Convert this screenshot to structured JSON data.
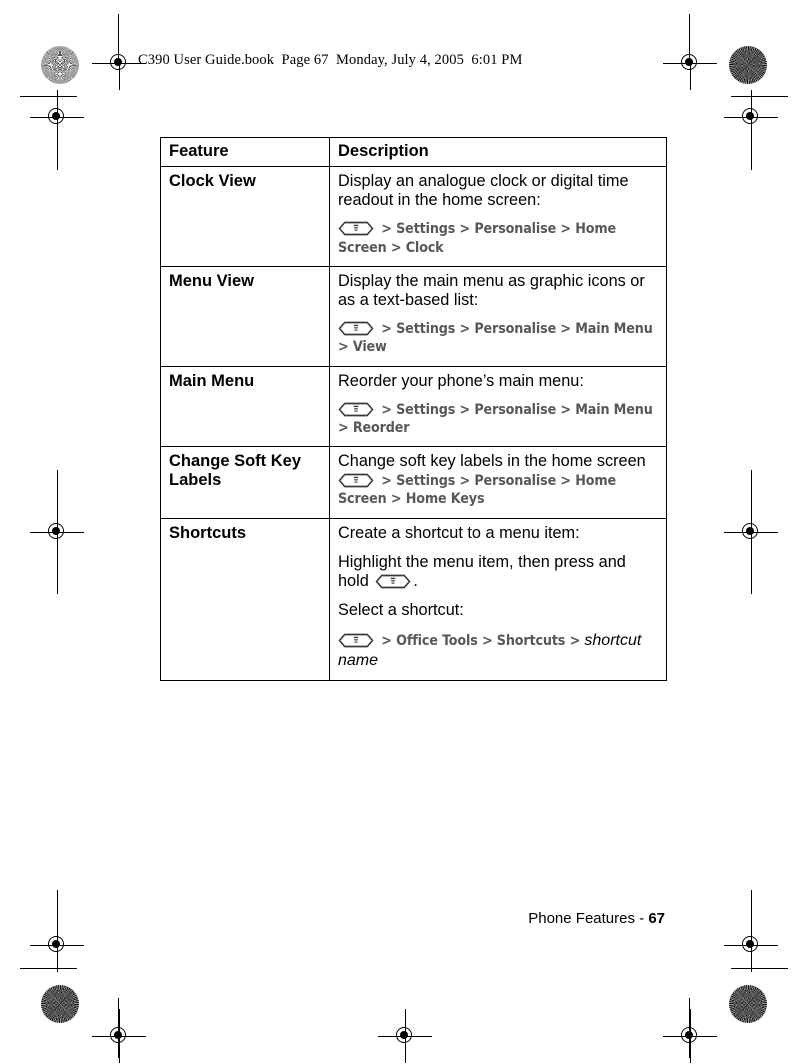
{
  "header": {
    "text": "C390 User Guide.book  Page 67  Monday, July 4, 2005  6:01 PM"
  },
  "footer": {
    "section": "Phone Features - ",
    "page_number": "67"
  },
  "table": {
    "columns": [
      "Feature",
      "Description"
    ],
    "rows": [
      {
        "feature": "Clock View",
        "paragraphs": [
          {
            "type": "text",
            "value": "Display an analogue clock or digital time readout in the home screen:"
          }
        ],
        "path": {
          "icon": "menu-key-icon",
          "segments": [
            "Settings",
            "Personalise",
            "Home Screen",
            "Clock"
          ]
        }
      },
      {
        "feature": "Menu View",
        "paragraphs": [
          {
            "type": "text",
            "value": "Display the main menu as graphic icons or as a text-based list:"
          }
        ],
        "path": {
          "icon": "menu-key-icon",
          "segments": [
            "Settings",
            "Personalise",
            "Main Menu",
            "View"
          ]
        }
      },
      {
        "feature": "Main Menu",
        "paragraphs": [
          {
            "type": "text",
            "value": "Reorder your phone’s main menu:"
          }
        ],
        "path": {
          "icon": "menu-key-icon",
          "segments": [
            "Settings",
            "Personalise",
            "Main Menu",
            "Reorder"
          ]
        }
      },
      {
        "feature": "Change Soft Key Labels",
        "paragraphs": [
          {
            "type": "text",
            "value": "Change soft key labels in the home screen",
            "tight": true
          }
        ],
        "path": {
          "icon": "menu-key-icon",
          "segments": [
            "Settings",
            "Personalise",
            "Home Screen",
            "Home Keys"
          ]
        }
      },
      {
        "feature": "Shortcuts",
        "paragraphs": [
          {
            "type": "text",
            "value": "Create a shortcut to a menu item:"
          },
          {
            "type": "text-with-icon",
            "before": "Highlight the menu item, then press and hold ",
            "icon": "menu-key-icon",
            "after": "."
          },
          {
            "type": "text",
            "value": "Select a shortcut:"
          }
        ],
        "path": {
          "icon": "menu-key-icon",
          "segments": [
            "Office Tools",
            "Shortcuts"
          ],
          "italic_segment": "shortcut name"
        }
      }
    ]
  },
  "separator": ">"
}
